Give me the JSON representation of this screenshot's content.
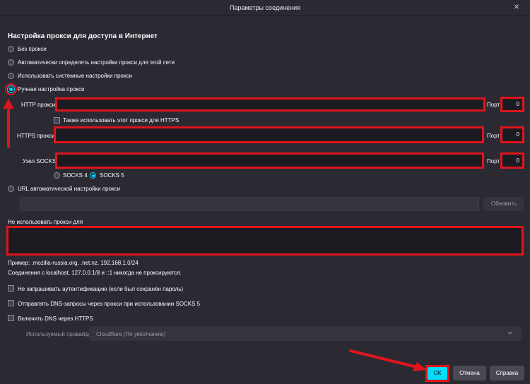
{
  "window": {
    "title": "Параметры соединения",
    "close_glyph": "✕"
  },
  "section_title": "Настройка прокси для доступа в Интернет",
  "proxy_options": [
    {
      "label": "Без прокси",
      "selected": false
    },
    {
      "label": "Автоматически определять настройки прокси для этой сети",
      "selected": false
    },
    {
      "label": "Использовать системные настройки прокси",
      "selected": false
    },
    {
      "label": "Ручная настройка прокси",
      "selected": true
    }
  ],
  "manual": {
    "http_label": "HTTP прокси",
    "http_value": "",
    "http_port_label": "Порт",
    "http_port": "0",
    "also_https_label": "Также использовать этот прокси для HTTPS",
    "https_label": "HTTPS прокси",
    "https_value": "",
    "https_port_label": "Порт",
    "https_port": "0",
    "socks_label": "Узел SOCKS",
    "socks_value": "",
    "socks_port_label": "Порт",
    "socks_port": "0",
    "socks4_label": "SOCKS 4",
    "socks5_label": "SOCKS 5",
    "socks_version_selected": "SOCKS 5"
  },
  "auto_url": {
    "label": "URL автоматической настройки прокси",
    "value": "",
    "reload_button": "Обновить"
  },
  "no_proxy": {
    "label": "Не использовать прокси для",
    "value": "",
    "example": "Пример: .mozilla-russia.org, .net.nz, 192.168.1.0/24",
    "note": "Соединения с localhost, 127.0.0.1/8 и ::1 никогда не проксируются."
  },
  "options": [
    {
      "label": "Не запрашивать аутентификацию (если был сохранён пароль)",
      "checked": false
    },
    {
      "label": "Отправлять DNS-запросы через прокси при использовании SOCKS 5",
      "checked": false
    },
    {
      "label": "Включить DNS через HTTPS",
      "checked": false
    }
  ],
  "doh": {
    "provider_label": "Используемый провайдер",
    "provider_value": "Cloudflare (По умолчанию)"
  },
  "buttons": {
    "ok": "ОК",
    "cancel": "Отмена",
    "help": "Справка"
  },
  "colors": {
    "background": "#2b2a33",
    "field": "#1c1b22",
    "accent": "#00ddff",
    "highlight": "#e0141c"
  }
}
